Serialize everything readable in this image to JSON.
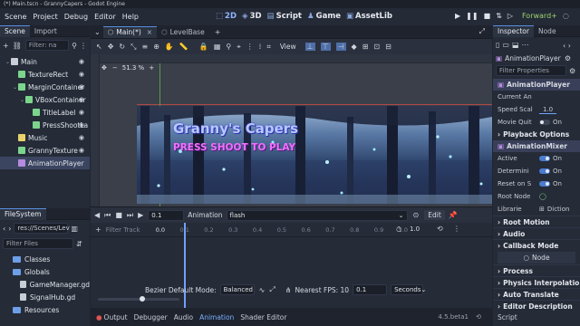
{
  "window_title": "(*) Main.tscn - GrannyCapers - Godot Engine",
  "menu": [
    "Scene",
    "Project",
    "Debug",
    "Editor",
    "Help"
  ],
  "workspaces": [
    {
      "label": "2D",
      "active": true
    },
    {
      "label": "3D",
      "active": false
    },
    {
      "label": "Script",
      "active": false
    },
    {
      "label": "Game",
      "active": false
    },
    {
      "label": "AssetLib",
      "active": false
    }
  ],
  "renderer": "Forward+",
  "scene_dock": {
    "tabs": [
      "Scene",
      "Import"
    ],
    "filter_placeholder": "Filter: na",
    "nodes": [
      {
        "label": "Main",
        "depth": 0,
        "color": "#c8cdd6",
        "selected": false
      },
      {
        "label": "TextureRect",
        "depth": 1,
        "color": "#7bd58c",
        "selected": false
      },
      {
        "label": "MarginContainer",
        "depth": 1,
        "color": "#7bd58c",
        "selected": false
      },
      {
        "label": "VBoxContainer",
        "depth": 2,
        "color": "#7bd58c",
        "selected": false
      },
      {
        "label": "TitleLabel",
        "depth": 3,
        "color": "#7bd58c",
        "selected": false
      },
      {
        "label": "PressShootLa",
        "depth": 3,
        "color": "#7bd58c",
        "selected": false
      },
      {
        "label": "Music",
        "depth": 1,
        "color": "#e8d36b",
        "selected": false
      },
      {
        "label": "GrannyTexture",
        "depth": 1,
        "color": "#7bd58c",
        "selected": false
      },
      {
        "label": "AnimationPlayer",
        "depth": 1,
        "color": "#b58be0",
        "selected": true
      }
    ]
  },
  "filesystem": {
    "title": "FileSystem",
    "path": "res://Scenes/Lev",
    "filter_placeholder": "Filter Files",
    "items": [
      {
        "label": "Classes",
        "type": "folder",
        "depth": 1
      },
      {
        "label": "Globals",
        "type": "folder",
        "depth": 1
      },
      {
        "label": "GameManager.gd",
        "type": "file",
        "depth": 2
      },
      {
        "label": "SignalHub.gd",
        "type": "file",
        "depth": 2
      },
      {
        "label": "Resources",
        "type": "folder",
        "depth": 1
      }
    ]
  },
  "editor_tabs": [
    {
      "label": "Main(*)",
      "active": true
    },
    {
      "label": "LevelBase",
      "active": false
    }
  ],
  "viewport": {
    "zoom": "51.3 %",
    "view_label": "View",
    "title_text": "Granny's Capers",
    "subtitle_text": "PRESS SHOOT TO PLAY"
  },
  "animation": {
    "time": "0.1",
    "label": "Animation",
    "current": "flash",
    "edit_label": "Edit",
    "length": "1.0",
    "filter_placeholder": "Filter Track",
    "ticks": [
      "0.0",
      "0.1",
      "0.2",
      "0.3",
      "0.4",
      "0.5",
      "0.6",
      "0.7",
      "0.8",
      "0.9",
      "1.0"
    ],
    "bezier_label": "Bezier Default Mode:",
    "bezier_mode": "Balanced",
    "nearest_fps_label": "Nearest FPS: 10",
    "snap": "0.1",
    "snap_unit": "Seconds"
  },
  "bottom_tabs": [
    {
      "label": "Output",
      "active": false
    },
    {
      "label": "Debugger",
      "active": false
    },
    {
      "label": "Audio",
      "active": false
    },
    {
      "label": "Animation",
      "active": true
    },
    {
      "label": "Shader Editor",
      "active": false
    }
  ],
  "version": "4.5.beta1",
  "inspector": {
    "tabs": [
      "Inspector",
      "Node"
    ],
    "node_name": "AnimationPlayer",
    "filter_placeholder": "Filter Properties",
    "header": "AnimationPlayer",
    "rows1": [
      {
        "label": "Current An",
        "value": "",
        "kind": "dropdown"
      },
      {
        "label": "Speed Scal",
        "value": "1.0",
        "kind": "number"
      },
      {
        "label": "Movie Quit",
        "value": "On",
        "kind": "toggle",
        "on": false
      }
    ],
    "playback_section": "Playback Options",
    "mixer_header": "AnimationMixer",
    "rows2": [
      {
        "label": "Active",
        "value": "On",
        "kind": "toggle",
        "on": true
      },
      {
        "label": "Determini",
        "value": "On",
        "kind": "toggle",
        "on": true
      },
      {
        "label": "Reset on S",
        "value": "On",
        "kind": "toggle",
        "on": true
      },
      {
        "label": "Root Node",
        "value": "",
        "kind": "node"
      },
      {
        "label": "Librarie",
        "value": "Diction",
        "kind": "dict"
      }
    ],
    "sections": [
      "Root Motion",
      "Audio",
      "Callback Mode"
    ],
    "node_label": "Node",
    "sections2": [
      "Process",
      "Physics Interpolation",
      "Auto Translate",
      "Editor Description"
    ],
    "script_label": "Script"
  }
}
